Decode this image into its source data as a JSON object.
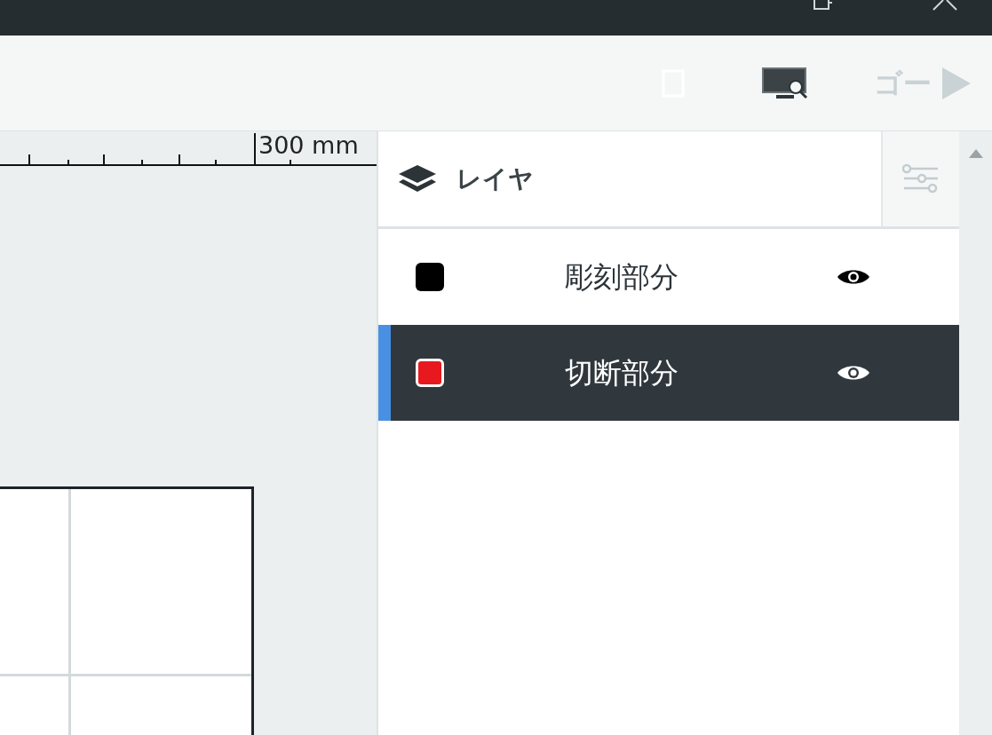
{
  "toolbar": {
    "go_button": {
      "label": "ゴー",
      "disabled": true
    }
  },
  "ruler": {
    "label": "300 mm"
  },
  "layers_panel": {
    "title": "レイヤ",
    "layers": [
      {
        "name": "彫刻部分",
        "color": "#000000",
        "visible": true,
        "selected": false
      },
      {
        "name": "切断部分",
        "color": "#e8191e",
        "visible": true,
        "selected": true
      }
    ]
  }
}
